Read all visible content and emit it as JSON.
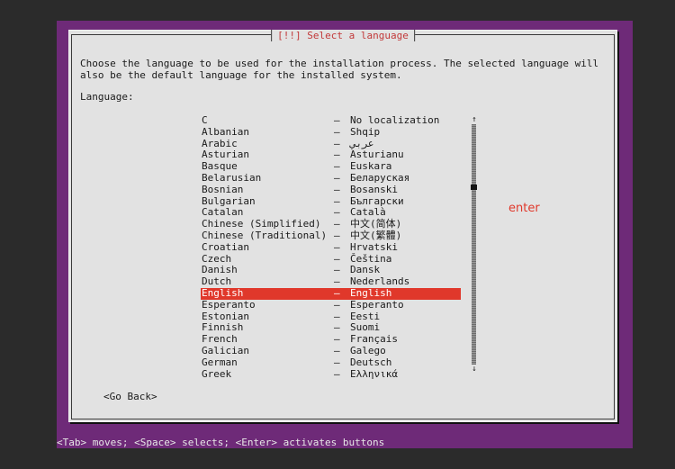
{
  "dialog": {
    "title": "[!!] Select a language",
    "prompt": "Choose the language to be used for the installation process. The selected language will\nalso be the default language for the installed system.",
    "field_label": "Language:",
    "go_back_label": "<Go Back>"
  },
  "languages": [
    {
      "name": "C",
      "sep": "–",
      "native": "No localization"
    },
    {
      "name": "Albanian",
      "sep": "–",
      "native": "Shqip"
    },
    {
      "name": "Arabic",
      "sep": "–",
      "native": "عربي"
    },
    {
      "name": "Asturian",
      "sep": "–",
      "native": "Asturianu"
    },
    {
      "name": "Basque",
      "sep": "–",
      "native": "Euskara"
    },
    {
      "name": "Belarusian",
      "sep": "–",
      "native": "Беларуская"
    },
    {
      "name": "Bosnian",
      "sep": "–",
      "native": "Bosanski"
    },
    {
      "name": "Bulgarian",
      "sep": "–",
      "native": "Български"
    },
    {
      "name": "Catalan",
      "sep": "–",
      "native": "Català"
    },
    {
      "name": "Chinese (Simplified)",
      "sep": "–",
      "native": "中文(简体)"
    },
    {
      "name": "Chinese (Traditional)",
      "sep": "–",
      "native": "中文(繁體)"
    },
    {
      "name": "Croatian",
      "sep": "–",
      "native": "Hrvatski"
    },
    {
      "name": "Czech",
      "sep": "–",
      "native": "Čeština"
    },
    {
      "name": "Danish",
      "sep": "–",
      "native": "Dansk"
    },
    {
      "name": "Dutch",
      "sep": "–",
      "native": "Nederlands"
    },
    {
      "name": "English",
      "sep": "–",
      "native": "English",
      "selected": true
    },
    {
      "name": "Esperanto",
      "sep": "–",
      "native": "Esperanto"
    },
    {
      "name": "Estonian",
      "sep": "–",
      "native": "Eesti"
    },
    {
      "name": "Finnish",
      "sep": "–",
      "native": "Suomi"
    },
    {
      "name": "French",
      "sep": "–",
      "native": "Français"
    },
    {
      "name": "Galician",
      "sep": "–",
      "native": "Galego"
    },
    {
      "name": "German",
      "sep": "–",
      "native": "Deutsch"
    },
    {
      "name": "Greek",
      "sep": "–",
      "native": "Ελληνικά"
    }
  ],
  "scrollbar": {
    "up_glyph": "↑",
    "down_glyph": "↓"
  },
  "annotation": "enter",
  "status_hint": "<Tab> moves; <Space> selects; <Enter> activates buttons",
  "colors": {
    "background": "#2b2b2b",
    "frame": "#6e2a78",
    "dialog": "#e2e2e2",
    "selection": "#e0382b",
    "title_text": "#c23a3a"
  }
}
